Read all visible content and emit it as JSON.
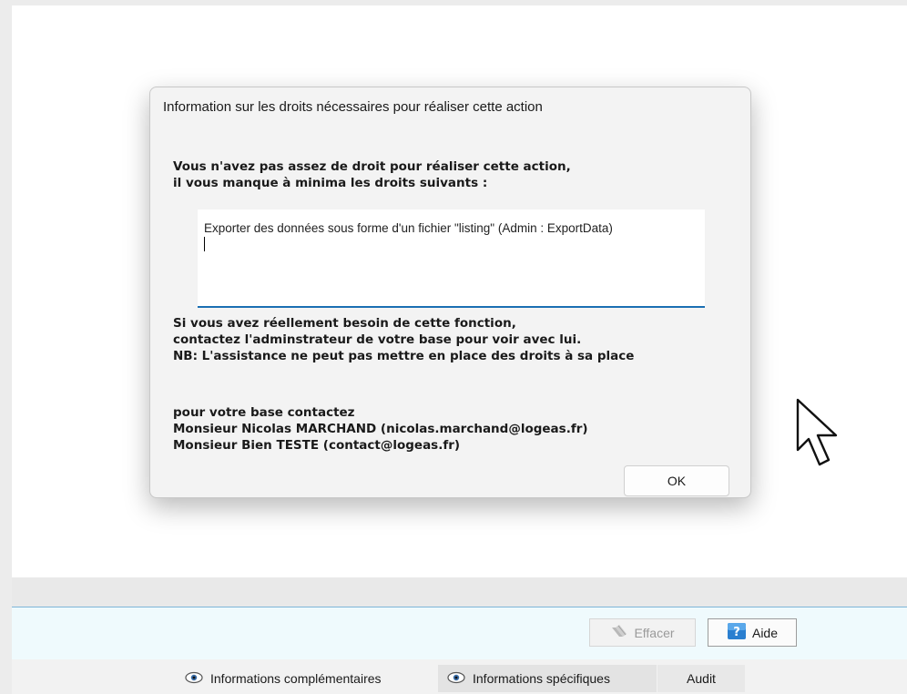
{
  "dialog": {
    "title": "Information sur les droits nécessaires pour réaliser cette action",
    "message_line1": "Vous n'avez pas assez de droit pour réaliser cette action,",
    "message_line2": "il vous manque à minima les droits suivants :",
    "rights_text": "Exporter des données sous forme d'un fichier \"listing\" (Admin : ExportData)",
    "contact_admin_line1": "Si vous avez réellement besoin de cette fonction,",
    "contact_admin_line2": "contactez l'adminstrateur de votre base pour voir avec lui.",
    "contact_admin_line3": "NB: L'assistance ne peut pas mettre en place des droits à sa place",
    "contacts_heading": "pour votre base contactez",
    "contact_1": "Monsieur Nicolas MARCHAND (nicolas.marchand@logeas.fr)",
    "contact_2": "Monsieur Bien TESTE (contact@logeas.fr)",
    "ok_label": "OK"
  },
  "toolbar": {
    "effacer_label": "Effacer",
    "effacer_icon": "eraser-icon",
    "aide_label": "Aide",
    "aide_icon": "help-icon"
  },
  "tabs": [
    {
      "label": "Informations complémentaires",
      "icon": "eye-icon"
    },
    {
      "label": "Informations spécifiques",
      "icon": "eye-icon"
    },
    {
      "label": "Audit"
    }
  ],
  "colors": {
    "accent_underline": "#1b6fb3",
    "toolbar_bg": "#effafd"
  }
}
